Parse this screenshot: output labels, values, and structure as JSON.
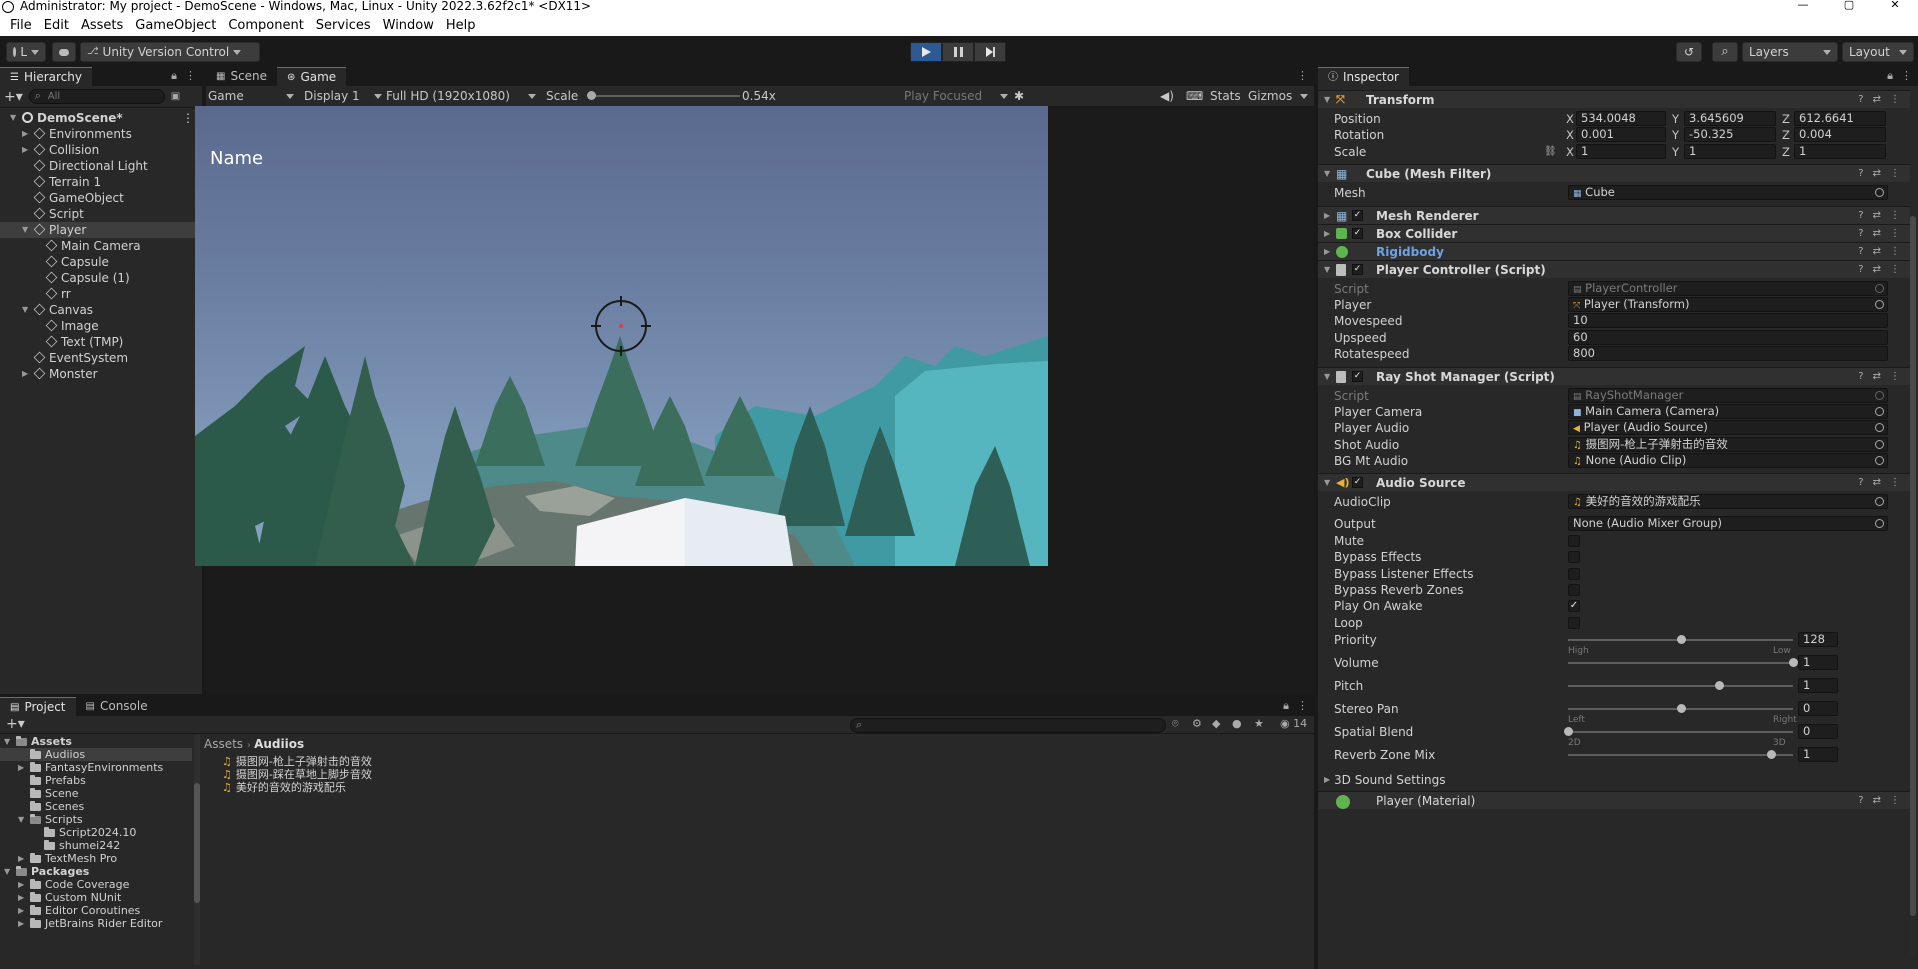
{
  "window": {
    "title": "Administrator: My project - DemoScene - Windows, Mac, Linux - Unity 2022.3.62f2c1* <DX11>",
    "minimize": "—",
    "maximize": "▢",
    "close": "✕"
  },
  "menu": [
    "File",
    "Edit",
    "Assets",
    "GameObject",
    "Component",
    "Services",
    "Window",
    "Help"
  ],
  "toolbar": {
    "account_label": "L",
    "version_control": "Unity Version Control",
    "layers": "Layers",
    "layout": "Layout"
  },
  "hierarchy": {
    "tab": "Hierarchy",
    "search_placeholder": "All",
    "items": [
      {
        "label": "DemoScene*",
        "depth": 0,
        "type": "scene",
        "expanded": true
      },
      {
        "label": "Environments",
        "depth": 1,
        "type": "go",
        "expandable": true
      },
      {
        "label": "Collision",
        "depth": 1,
        "type": "go",
        "expandable": true
      },
      {
        "label": "Directional Light",
        "depth": 1,
        "type": "go"
      },
      {
        "label": "Terrain 1",
        "depth": 1,
        "type": "go"
      },
      {
        "label": "GameObject",
        "depth": 1,
        "type": "go"
      },
      {
        "label": "Script",
        "depth": 1,
        "type": "go"
      },
      {
        "label": "Player",
        "depth": 1,
        "type": "go",
        "expanded": true,
        "selected": true
      },
      {
        "label": "Main Camera",
        "depth": 2,
        "type": "go"
      },
      {
        "label": "Capsule",
        "depth": 2,
        "type": "go"
      },
      {
        "label": "Capsule (1)",
        "depth": 2,
        "type": "go"
      },
      {
        "label": "rr",
        "depth": 2,
        "type": "go"
      },
      {
        "label": "Canvas",
        "depth": 1,
        "type": "go",
        "expanded": true
      },
      {
        "label": "Image",
        "depth": 2,
        "type": "go"
      },
      {
        "label": "Text (TMP)",
        "depth": 2,
        "type": "go"
      },
      {
        "label": "EventSystem",
        "depth": 1,
        "type": "go"
      },
      {
        "label": "Monster",
        "depth": 1,
        "type": "go",
        "expandable": true
      }
    ]
  },
  "scene_tabs": {
    "scene": "Scene",
    "game": "Game"
  },
  "game_toolbar": {
    "mode": "Game",
    "display": "Display 1",
    "resolution": "Full HD (1920x1080)",
    "scale_label": "Scale",
    "scale_value": "0.54x",
    "play_focused": "Play Focused",
    "stats": "Stats",
    "gizmos": "Gizmos"
  },
  "game_view": {
    "name_label": "Name"
  },
  "bottom_tabs": {
    "project": "Project",
    "console": "Console"
  },
  "project": {
    "breadcrumb": [
      "Assets",
      "Audiios"
    ],
    "hidden_count": "14",
    "tree": [
      {
        "label": "Assets",
        "depth": 0,
        "bold": true,
        "expanded": true
      },
      {
        "label": "Audiios",
        "depth": 1,
        "selected": true
      },
      {
        "label": "FantasyEnvironments",
        "depth": 1,
        "expandable": true
      },
      {
        "label": "Prefabs",
        "depth": 1
      },
      {
        "label": "Scene",
        "depth": 1
      },
      {
        "label": "Scenes",
        "depth": 1
      },
      {
        "label": "Scripts",
        "depth": 1,
        "expanded": true
      },
      {
        "label": "Script2024.10",
        "depth": 2
      },
      {
        "label": "shumei242",
        "depth": 2
      },
      {
        "label": "TextMesh Pro",
        "depth": 1,
        "expandable": true
      },
      {
        "label": "Packages",
        "depth": 0,
        "bold": true,
        "expanded": true
      },
      {
        "label": "Code Coverage",
        "depth": 1,
        "expandable": true
      },
      {
        "label": "Custom NUnit",
        "depth": 1,
        "expandable": true
      },
      {
        "label": "Editor Coroutines",
        "depth": 1,
        "expandable": true
      },
      {
        "label": "JetBrains Rider Editor",
        "depth": 1,
        "expandable": true
      }
    ],
    "files": [
      "摄图网-枪上子弹射击的音效",
      "摄图网-踩在草地上脚步音效",
      "美好的音效的游戏配乐"
    ]
  },
  "inspector": {
    "tab": "Inspector",
    "transform": {
      "title": "Transform",
      "position": {
        "label": "Position",
        "x": "534.0048",
        "y": "3.645609",
        "z": "612.6641"
      },
      "rotation": {
        "label": "Rotation",
        "x": "0.001",
        "y": "-50.325",
        "z": "0.004"
      },
      "scale": {
        "label": "Scale",
        "x": "1",
        "y": "1",
        "z": "1"
      }
    },
    "mesh_filter": {
      "title": "Cube (Mesh Filter)",
      "mesh_label": "Mesh",
      "mesh_value": "Cube"
    },
    "mesh_renderer": {
      "title": "Mesh Renderer"
    },
    "box_collider": {
      "title": "Box Collider"
    },
    "rigidbody": {
      "title": "Rigidbody"
    },
    "player_controller": {
      "title": "Player Controller (Script)",
      "script_label": "Script",
      "script_value": "PlayerController",
      "player_label": "Player",
      "player_value": "Player (Transform)",
      "movespeed_label": "Movespeed",
      "movespeed_value": "10",
      "upspeed_label": "Upspeed",
      "upspeed_value": "60",
      "rotatespeed_label": "Rotatespeed",
      "rotatespeed_value": "800"
    },
    "ray_shot": {
      "title": "Ray Shot Manager (Script)",
      "script_label": "Script",
      "script_value": "RayShotManager",
      "camera_label": "Player Camera",
      "camera_value": "Main Camera (Camera)",
      "audio_label": "Player Audio",
      "audio_value": "Player (Audio Source)",
      "shot_label": "Shot Audio",
      "shot_value": "摄图网-枪上子弹射击的音效",
      "bg_label": "BG Mt Audio",
      "bg_value": "None (Audio Clip)"
    },
    "audio_source": {
      "title": "Audio Source",
      "clip_label": "AudioClip",
      "clip_value": "美好的音效的游戏配乐",
      "output_label": "Output",
      "output_value": "None (Audio Mixer Group)",
      "checks": [
        {
          "label": "Mute",
          "checked": false
        },
        {
          "label": "Bypass Effects",
          "checked": false
        },
        {
          "label": "Bypass Listener Effects",
          "checked": false
        },
        {
          "label": "Bypass Reverb Zones",
          "checked": false
        },
        {
          "label": "Play On Awake",
          "checked": true
        },
        {
          "label": "Loop",
          "checked": false
        }
      ],
      "sliders": [
        {
          "label": "Priority",
          "value": "128",
          "fraction": 0.5,
          "left": "High",
          "right": "Low"
        },
        {
          "label": "Volume",
          "value": "1",
          "fraction": 1.0
        },
        {
          "label": "Pitch",
          "value": "1",
          "fraction": 0.67
        },
        {
          "label": "Stereo Pan",
          "value": "0",
          "fraction": 0.5,
          "left": "Left",
          "right": "Right"
        },
        {
          "label": "Spatial Blend",
          "value": "0",
          "fraction": 0.0,
          "left": "2D",
          "right": "3D"
        },
        {
          "label": "Reverb Zone Mix",
          "value": "1",
          "fraction": 0.9
        }
      ],
      "sound_settings": "3D Sound Settings"
    },
    "material": {
      "title": "Player (Material)"
    }
  },
  "colors": {
    "accent": "#2d5a92",
    "sky": "#6b7fa3",
    "rigidbody_title": "#6ea0e6"
  }
}
